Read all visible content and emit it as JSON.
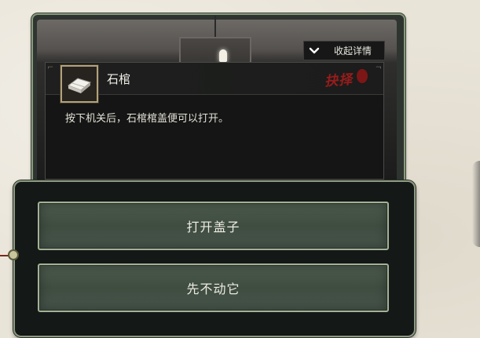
{
  "detail_panel": {
    "collapse_label": "收起详情",
    "item": {
      "name": "石棺",
      "stamp": "抉择",
      "description": "按下机关后，石棺棺盖便可以打开。"
    }
  },
  "choices": [
    {
      "label": "打开盖子"
    },
    {
      "label": "先不动它"
    }
  ],
  "colors": {
    "stamp_red": "#a51c1c",
    "button_green": "#46544a",
    "frame_sage": "#8d9b82"
  },
  "icons": {
    "collapse": "chevron-down-icon",
    "item": "stone-coffin-icon"
  }
}
